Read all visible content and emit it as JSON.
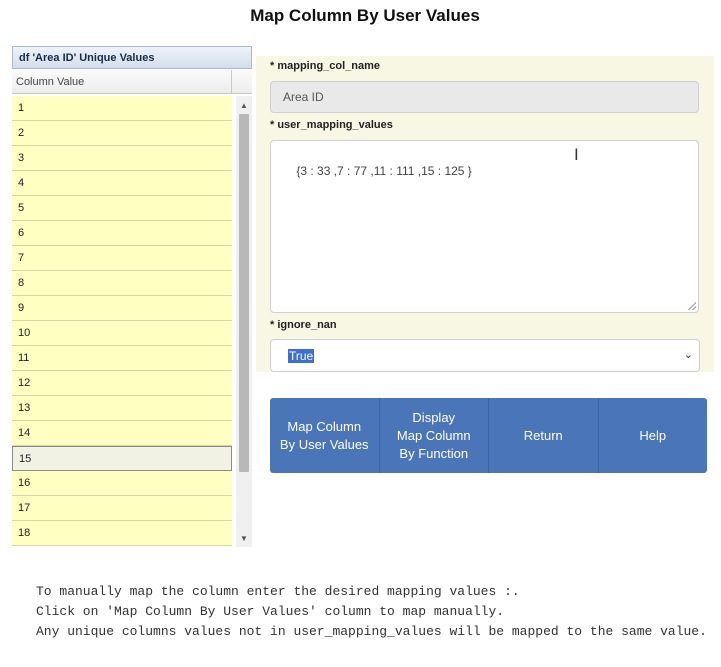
{
  "page": {
    "title": "Map Column By User Values"
  },
  "grid": {
    "title": "df 'Area ID' Unique Values",
    "column_header": "Column Value",
    "rows": [
      "1",
      "2",
      "3",
      "4",
      "5",
      "6",
      "7",
      "8",
      "9",
      "10",
      "11",
      "12",
      "13",
      "14",
      "15",
      "16",
      "17",
      "18"
    ],
    "selected_row": "15"
  },
  "form": {
    "mapping_col_name": {
      "label": "* mapping_col_name",
      "value": "Area ID"
    },
    "user_mapping_values": {
      "label": "* user_mapping_values",
      "value": "{3 : 33 ,7 : 77 ,11 : 111 ,15 : 125 }"
    },
    "ignore_nan": {
      "label": "* ignore_nan",
      "value": "True"
    }
  },
  "buttons": [
    {
      "name": "map-column-by-user-values-button",
      "label": "Map Column\nBy User Values"
    },
    {
      "name": "display-map-column-by-function-button",
      "label": "Display\nMap Column\nBy Function"
    },
    {
      "name": "return-button",
      "label": "Return"
    },
    {
      "name": "help-button",
      "label": "Help"
    }
  ],
  "notes": [
    "To manually map the column enter the desired mapping values :.",
    "Click on 'Map Column By User Values' column to map manually.",
    "Any unique columns values not in user_mapping_values will be mapped to the same value."
  ],
  "colors": {
    "accent": "#4a76b9",
    "row_bg": "#ffffc2",
    "panel_bg": "#f7f7e3"
  },
  "icons": {
    "dropdown": "chevron-down-icon",
    "cursor": "text-cursor-icon"
  }
}
